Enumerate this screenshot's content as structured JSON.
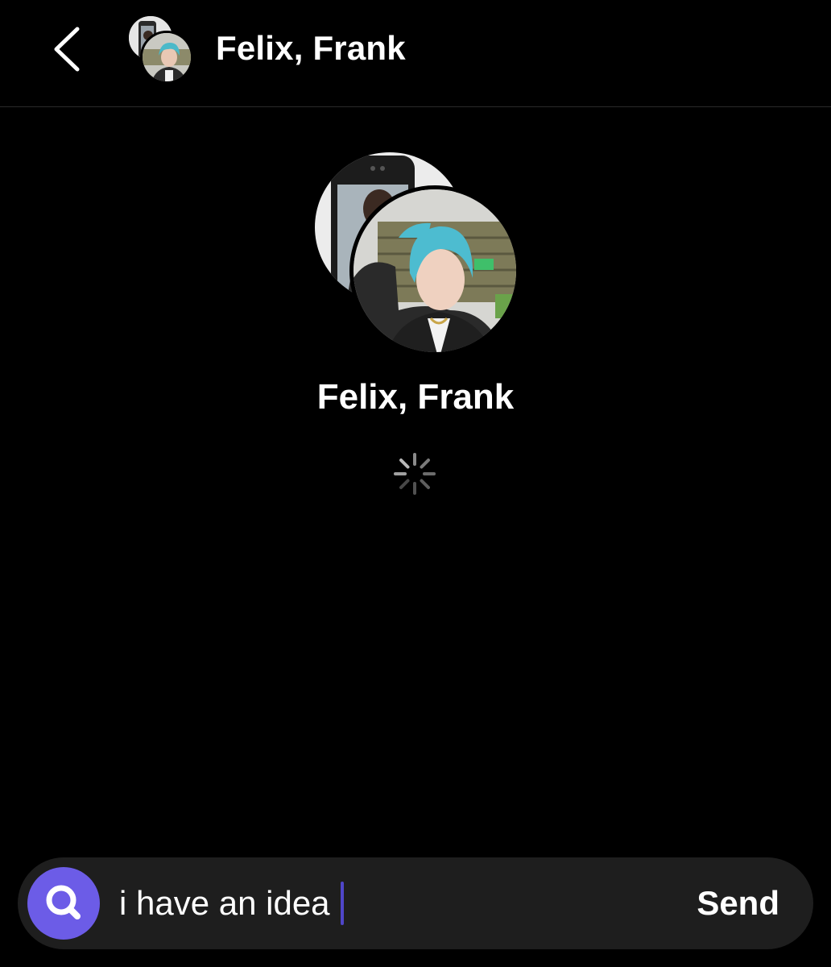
{
  "header": {
    "title": "Felix, Frank",
    "back_icon": "chevron-left-icon"
  },
  "profile": {
    "name": "Felix, Frank"
  },
  "loading": {
    "icon": "spinner-icon"
  },
  "composer": {
    "search_icon": "search-icon",
    "message_value": "i have an idea",
    "send_label": "Send",
    "accent_color": "#6c5ce7"
  }
}
